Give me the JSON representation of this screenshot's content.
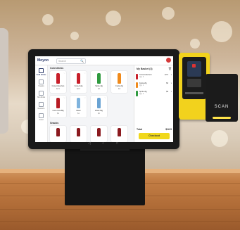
{
  "app": {
    "title": "Moyoo",
    "search_placeholder": "Search",
    "search_icon": "🔍"
  },
  "sidebar": {
    "items": [
      {
        "label": "Cold drinks",
        "active": true
      },
      {
        "label": "Snacks"
      },
      {
        "label": "Hot drinks"
      },
      {
        "label": "Desserts"
      },
      {
        "label": "Food"
      }
    ]
  },
  "main": {
    "section1": "Cold drinks",
    "section2": "Snacks",
    "products": [
      {
        "name": "Coca-Cola Zero",
        "price": "$2.5",
        "color": "#c81f2a"
      },
      {
        "name": "Coca-Cola",
        "price": "$2.5",
        "color": "#c81f2a"
      },
      {
        "name": "Sprite 2lg",
        "price": "$3",
        "color": "#2f9a3f"
      },
      {
        "name": "Fanta 2lg",
        "price": "$3",
        "color": "#f08a1b"
      },
      {
        "name": "Coca-Cola Big",
        "price": "$4",
        "color": "#b71c24"
      },
      {
        "name": "Water",
        "price": "$1",
        "color": "#7fb3dd"
      },
      {
        "name": "Water Big",
        "price": "$2",
        "color": "#6aa3d3"
      }
    ],
    "snacks": [
      "#8b1a1f",
      "#8b1a1f",
      "#8b1a1f",
      "#8b1a1f",
      "#8b1a1f"
    ]
  },
  "cart": {
    "title": "My Basket (3)",
    "trash_icon": "🗑",
    "items": [
      {
        "name": "Coca-Cola Zero",
        "qty": "Qty: 3",
        "price": "$7.5",
        "color": "#c81f2a"
      },
      {
        "name": "Fanta 2lg",
        "qty": "Qty: 1",
        "price": "$3",
        "color": "#f08a1b"
      },
      {
        "name": "Sprite 2lg",
        "qty": "Qty: 2",
        "price": "$6",
        "color": "#2f9a3f"
      }
    ],
    "total_label": "Total",
    "total_value": "$16.5",
    "checkout_label": "Checkout"
  },
  "scanner": {
    "label": "SCAN"
  },
  "nav": {
    "back": "◁",
    "home": "○",
    "recent": "□"
  }
}
